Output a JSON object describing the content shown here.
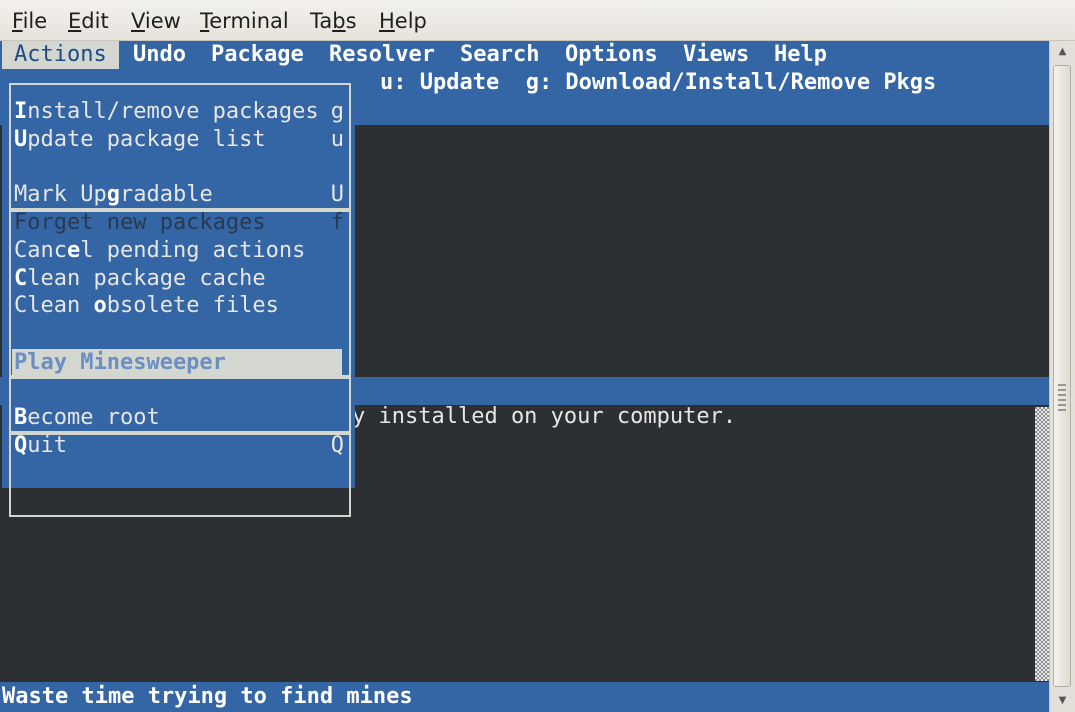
{
  "window_menu": {
    "items": [
      {
        "mn": "F",
        "rest": "ile"
      },
      {
        "mn": "E",
        "rest": "dit"
      },
      {
        "mn": "V",
        "rest": "iew"
      },
      {
        "mn": "T",
        "rest": "erminal"
      },
      {
        "pre": "Ta",
        "mn": "b",
        "rest": "s"
      },
      {
        "mn": "H",
        "rest": "elp"
      }
    ]
  },
  "aptitude": {
    "menubar": [
      "Actions",
      "Undo",
      "Package",
      "Resolver",
      "Search",
      "Options",
      "Views",
      "Help"
    ],
    "hint": "u: Update  g: Download/Install/Remove Pkgs",
    "content_text": "y installed on your computer.",
    "status_text": "Waste time trying to find mines"
  },
  "actions_menu": {
    "groups": [
      [
        {
          "pre": "",
          "mn": "I",
          "rest": "nstall/remove packages",
          "key": "g",
          "state": "normal"
        },
        {
          "pre": "",
          "mn": "U",
          "rest": "pdate package list",
          "key": "u",
          "state": "normal"
        }
      ],
      [
        {
          "pre": "Mark Up",
          "mn": "g",
          "rest": "radable",
          "key": "U",
          "state": "normal"
        },
        {
          "pre": "Forget new packages",
          "mn": "",
          "rest": "",
          "key": "f",
          "state": "disabled"
        },
        {
          "pre": "Canc",
          "mn": "e",
          "rest": "l pending actions",
          "key": "",
          "state": "normal"
        },
        {
          "pre": "",
          "mn": "C",
          "rest": "lean package cache",
          "key": "",
          "state": "normal"
        },
        {
          "pre": "Clean ",
          "mn": "o",
          "rest": "bsolete files",
          "key": "",
          "state": "normal"
        }
      ],
      [
        {
          "pre": "Play Minesweeper",
          "mn": "",
          "rest": "",
          "key": "",
          "state": "selected"
        }
      ],
      [
        {
          "pre": "",
          "mn": "B",
          "rest": "ecome root",
          "key": "",
          "state": "normal"
        },
        {
          "pre": "",
          "mn": "Q",
          "rest": "uit",
          "key": "Q",
          "state": "normal"
        }
      ]
    ]
  },
  "colors": {
    "terminal_bg": "#2c3033",
    "aptitude_blue": "#3465a4",
    "highlight": "#d3d7cf"
  }
}
